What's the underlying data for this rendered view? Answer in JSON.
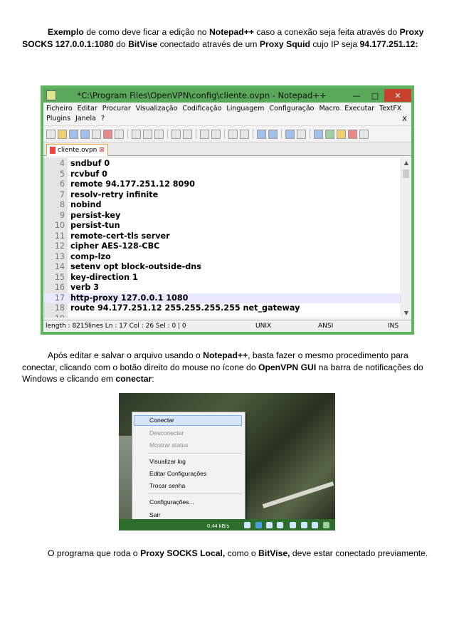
{
  "intro": {
    "pre": "Exemplo",
    "t1": " de como deve ficar a edição no ",
    "b1": "Notepad++",
    "t2": " caso a conexão seja feita através do ",
    "b2": "Proxy SOCKS 127.0.0.1:1080",
    "t3": " do ",
    "b3": "BitVise",
    "t4": " conectado através de um ",
    "b4": "Proxy Squid",
    "t5": " cujo IP seja ",
    "b5": "94.177.251.12:"
  },
  "notepad": {
    "title": "*C:\\Program Files\\OpenVPN\\config\\cliente.ovpn - Notepad++",
    "menu": [
      "Ficheiro",
      "Editar",
      "Procurar",
      "Visualização",
      "Codificação",
      "Linguagem",
      "Configuração",
      "Macro",
      "Executar",
      "TextFX",
      "Plugins",
      "Janela",
      "?"
    ],
    "menu_close": "X",
    "tab": "cliente.ovpn",
    "tab_close": "⊠",
    "lines": [
      {
        "n": "4",
        "t": "sndbuf 0"
      },
      {
        "n": "5",
        "t": "rcvbuf 0"
      },
      {
        "n": "6",
        "t": "remote 94.177.251.12 8090"
      },
      {
        "n": "7",
        "t": "resolv-retry infinite"
      },
      {
        "n": "8",
        "t": "nobind"
      },
      {
        "n": "9",
        "t": "persist-key"
      },
      {
        "n": "10",
        "t": "persist-tun"
      },
      {
        "n": "11",
        "t": "remote-cert-tls server"
      },
      {
        "n": "12",
        "t": "cipher AES-128-CBC"
      },
      {
        "n": "13",
        "t": "comp-lzo"
      },
      {
        "n": "14",
        "t": "setenv opt block-outside-dns"
      },
      {
        "n": "15",
        "t": "key-direction 1"
      },
      {
        "n": "16",
        "t": "verb 3"
      },
      {
        "n": "17",
        "t": "http-proxy 127.0.0.1 1080"
      },
      {
        "n": "18",
        "t": "route 94.177.251.12 255.255.255.255 net_gateway"
      },
      {
        "n": "19",
        "t": ""
      }
    ],
    "highlighted_line": "17",
    "status": {
      "length": "length : 8215",
      "lines": "lines  Ln : 17   Col : 26   Sel : 0 | 0",
      "eol": "UNIX",
      "enc": "ANSI",
      "mode": "INS"
    }
  },
  "middle": {
    "t1": "Após editar e salvar o arquivo usando o ",
    "b1": "Notepad++",
    "t2": ", basta fazer o mesmo procedimento para conectar, clicando com o botão direito do mouse no ícone do ",
    "b2": "OpenVPN GUI",
    "t3": " na barra de notificações do Windows e clicando em ",
    "b3": "conectar",
    "t4": ":"
  },
  "context_menu": {
    "items": [
      {
        "label": "Conectar",
        "enabled": true
      },
      {
        "label": "Desconectar",
        "enabled": false
      },
      {
        "label": "Mostrar status",
        "enabled": false
      },
      {
        "label": "Visualizar log",
        "enabled": true
      },
      {
        "label": "Editar Configurações",
        "enabled": true
      },
      {
        "label": "Trocar senha",
        "enabled": true
      },
      {
        "label": "Configurações...",
        "enabled": true
      },
      {
        "label": "Sair",
        "enabled": true
      }
    ],
    "speed": "0.44 kB/s"
  },
  "closing": {
    "t1": "O programa que roda o ",
    "b1": "Proxy SOCKS Local,",
    "t2": " como o ",
    "b2": "BitVise,",
    "t3": " deve estar conectado previamente."
  }
}
